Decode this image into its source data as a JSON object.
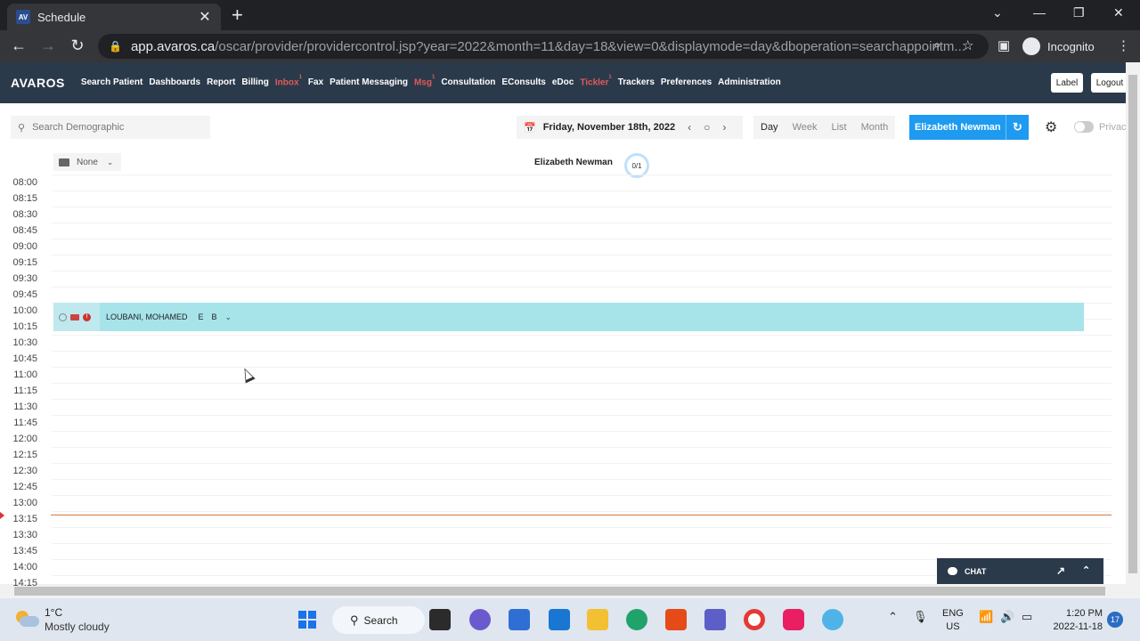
{
  "browser": {
    "tab_title": "Schedule",
    "tab_favicon": "AV",
    "url_host": "app.avaros.ca",
    "url_path": "/oscar/provider/providercontrol.jsp?year=2022&month=11&day=18&view=0&displaymode=day&dboperation=searchappointm...",
    "incognito_label": "Incognito"
  },
  "nav": {
    "logo": "AVAROS",
    "items": [
      {
        "label": "Search Patient",
        "alert": false,
        "badge": ""
      },
      {
        "label": "Dashboards",
        "alert": false,
        "badge": ""
      },
      {
        "label": "Report",
        "alert": false,
        "badge": ""
      },
      {
        "label": "Billing",
        "alert": false,
        "badge": ""
      },
      {
        "label": "Inbox",
        "alert": true,
        "badge": "1"
      },
      {
        "label": "Fax",
        "alert": false,
        "badge": ""
      },
      {
        "label": "Patient Messaging",
        "alert": false,
        "badge": ""
      },
      {
        "label": "Msg",
        "alert": true,
        "badge": "1"
      },
      {
        "label": "Consultation",
        "alert": false,
        "badge": ""
      },
      {
        "label": "EConsults",
        "alert": false,
        "badge": ""
      },
      {
        "label": "eDoc",
        "alert": false,
        "badge": ""
      },
      {
        "label": "Tickler",
        "alert": true,
        "badge": "1"
      },
      {
        "label": "Trackers",
        "alert": false,
        "badge": ""
      },
      {
        "label": "Preferences",
        "alert": false,
        "badge": ""
      },
      {
        "label": "Administration",
        "alert": false,
        "badge": ""
      }
    ],
    "label_button": "Label",
    "logout_button": "Logout"
  },
  "toolbar": {
    "search_placeholder": "Search Demographic",
    "date": "Friday, November 18th, 2022",
    "views": [
      "Day",
      "Week",
      "List",
      "Month"
    ],
    "active_view": "Day",
    "provider": "Elizabeth Newman",
    "privacy_label": "Privac"
  },
  "schedule": {
    "folder_filter": "None",
    "provider_name": "Elizabeth Newman",
    "progress_label": "0/1",
    "times": [
      "08:00",
      "08:15",
      "08:30",
      "08:45",
      "09:00",
      "09:15",
      "09:30",
      "09:45",
      "10:00",
      "10:15",
      "10:30",
      "10:45",
      "11:00",
      "11:15",
      "11:30",
      "11:45",
      "12:00",
      "12:15",
      "12:30",
      "12:45",
      "13:00",
      "13:15",
      "13:30",
      "13:45",
      "14:00",
      "14:15"
    ],
    "appointment": {
      "patient": "LOUBANI, MOHAMED",
      "flags": [
        "E",
        "B"
      ]
    }
  },
  "chat": {
    "label": "CHAT"
  },
  "taskbar": {
    "temperature": "1°C",
    "condition": "Mostly cloudy",
    "search_label": "Search",
    "lang_top": "ENG",
    "lang_bottom": "US",
    "time": "1:20 PM",
    "date": "2022-11-18",
    "notifications": "17"
  },
  "colors": {
    "nav_bg": "#2b3a4a",
    "accent": "#1e9bf0",
    "appointment": "#a6e4ea",
    "now_line": "#d9783a"
  }
}
